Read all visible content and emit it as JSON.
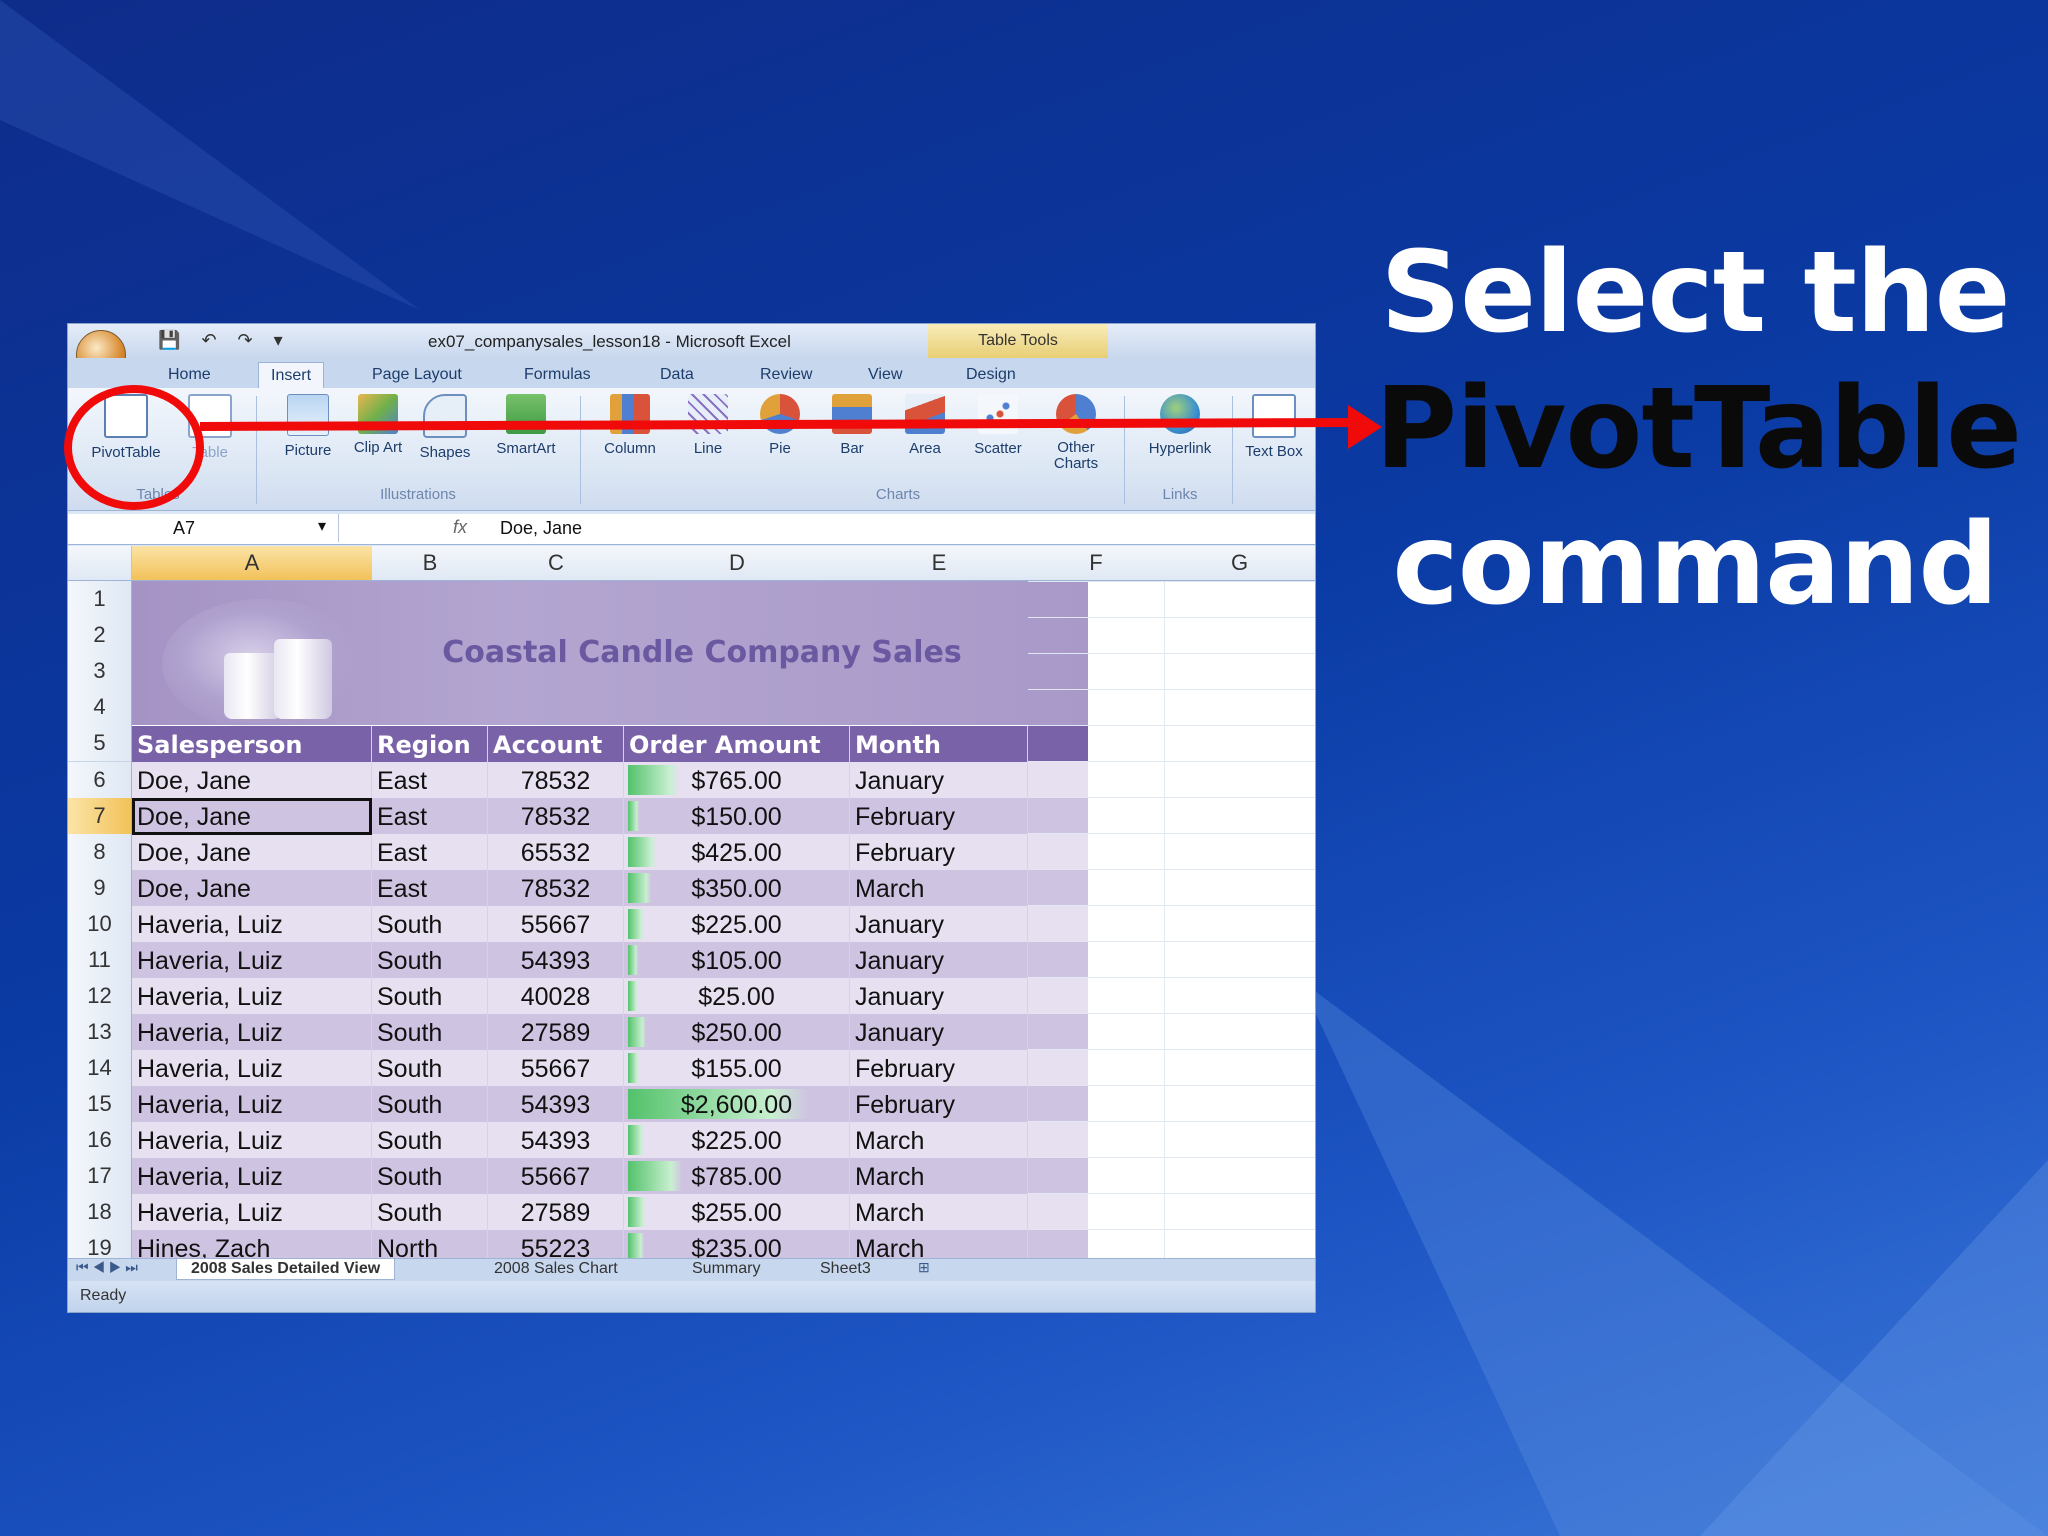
{
  "slide": {
    "line1": "Select the",
    "line2": "PivotTable",
    "line3": "command"
  },
  "excel": {
    "window_title": "ex07_companysales_lesson18 - Microsoft Excel",
    "context_tab_title": "Table Tools",
    "tabs": [
      "Home",
      "Insert",
      "Page Layout",
      "Formulas",
      "Data",
      "Review",
      "View",
      "Design"
    ],
    "active_tab": "Insert",
    "ribbon": {
      "pivottable": "PivotTable",
      "table": "Table",
      "tables_group": "Tables",
      "picture": "Picture",
      "clip_art": "Clip Art",
      "shapes": "Shapes",
      "smartart": "SmartArt",
      "illustrations_group": "Illustrations",
      "column": "Column",
      "line": "Line",
      "pie": "Pie",
      "bar": "Bar",
      "area": "Area",
      "scatter": "Scatter",
      "other_charts": "Other Charts",
      "charts_group": "Charts",
      "hyperlink": "Hyperlink",
      "links_group": "Links",
      "text_box": "Text Box"
    },
    "name_box": "A7",
    "fx_symbol": "fx",
    "formula": "Doe, Jane",
    "columns": [
      "A",
      "B",
      "C",
      "D",
      "E",
      "F",
      "G"
    ],
    "banner_title": "Coastal Candle Company Sales",
    "headers": [
      "Salesperson",
      "Region",
      "Account",
      "Order Amount",
      "Month"
    ],
    "rows": [
      {
        "n": "6",
        "name": "Doe, Jane",
        "region": "East",
        "account": "78532",
        "amount": "$765.00",
        "month": "January",
        "bar": 0.29
      },
      {
        "n": "7",
        "name": "Doe, Jane",
        "region": "East",
        "account": "78532",
        "amount": "$150.00",
        "month": "February",
        "bar": 0.06
      },
      {
        "n": "8",
        "name": "Doe, Jane",
        "region": "East",
        "account": "65532",
        "amount": "$425.00",
        "month": "February",
        "bar": 0.16
      },
      {
        "n": "9",
        "name": "Doe, Jane",
        "region": "East",
        "account": "78532",
        "amount": "$350.00",
        "month": "March",
        "bar": 0.13
      },
      {
        "n": "10",
        "name": "Haveria, Luiz",
        "region": "South",
        "account": "55667",
        "amount": "$225.00",
        "month": "January",
        "bar": 0.09
      },
      {
        "n": "11",
        "name": "Haveria, Luiz",
        "region": "South",
        "account": "54393",
        "amount": "$105.00",
        "month": "January",
        "bar": 0.04
      },
      {
        "n": "12",
        "name": "Haveria, Luiz",
        "region": "South",
        "account": "40028",
        "amount": "$25.00",
        "month": "January",
        "bar": 0.01
      },
      {
        "n": "13",
        "name": "Haveria, Luiz",
        "region": "South",
        "account": "27589",
        "amount": "$250.00",
        "month": "January",
        "bar": 0.1
      },
      {
        "n": "14",
        "name": "Haveria, Luiz",
        "region": "South",
        "account": "55667",
        "amount": "$155.00",
        "month": "February",
        "bar": 0.06
      },
      {
        "n": "15",
        "name": "Haveria, Luiz",
        "region": "South",
        "account": "54393",
        "amount": "$2,600.00",
        "month": "February",
        "bar": 1.0
      },
      {
        "n": "16",
        "name": "Haveria, Luiz",
        "region": "South",
        "account": "54393",
        "amount": "$225.00",
        "month": "March",
        "bar": 0.09
      },
      {
        "n": "17",
        "name": "Haveria, Luiz",
        "region": "South",
        "account": "55667",
        "amount": "$785.00",
        "month": "March",
        "bar": 0.3
      },
      {
        "n": "18",
        "name": "Haveria, Luiz",
        "region": "South",
        "account": "27589",
        "amount": "$255.00",
        "month": "March",
        "bar": 0.1
      },
      {
        "n": "19",
        "name": "Hines, Zach",
        "region": "North",
        "account": "55223",
        "amount": "$235.00",
        "month": "March",
        "bar": 0.09
      }
    ],
    "header_row_numbers": [
      "1",
      "2",
      "3",
      "4",
      "5"
    ],
    "sheet_tabs": [
      "2008 Sales Detailed View",
      "2008 Sales Chart",
      "Summary",
      "Sheet3"
    ],
    "status": "Ready"
  },
  "colors": {
    "annotation": "#f00a0a",
    "header_purple": "#7a62a8",
    "banner_purple": "#a493c4",
    "row_light": "#e7e0f0",
    "row_dark": "#cfc3e2"
  }
}
